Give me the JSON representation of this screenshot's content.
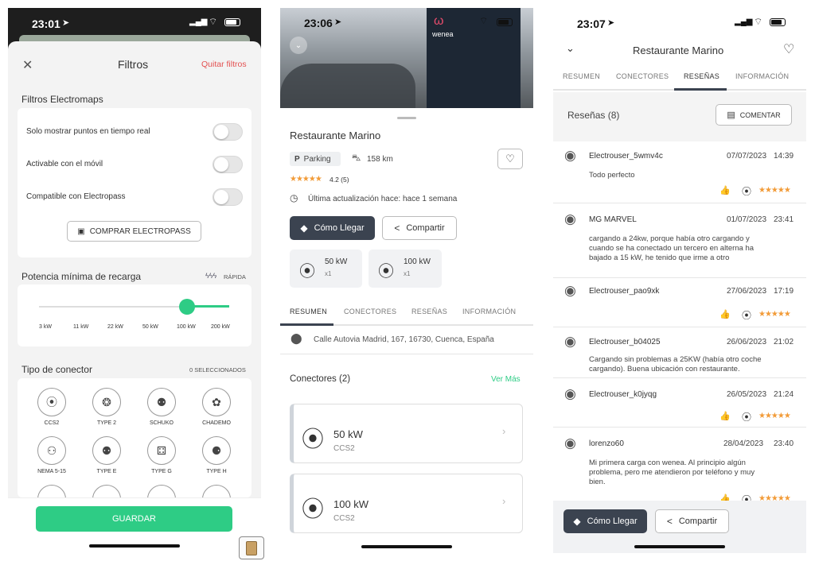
{
  "left": {
    "time": "23:01",
    "header": {
      "title": "Filtros",
      "clear": "Quitar filtros"
    },
    "electromaps": {
      "title": "Filtros Electromaps",
      "toggles": [
        "Solo mostrar puntos en tiempo real",
        "Activable con el móvil",
        "Compatible con Electropass"
      ],
      "buy_button": "COMPRAR ELECTROPASS"
    },
    "power": {
      "title": "Potencia mínima de recarga",
      "badge": "RÁPIDA",
      "ticks": [
        "3 kW",
        "11 kW",
        "22 kW",
        "50 kW",
        "100 kW",
        "200 kW"
      ],
      "selected_index": 4
    },
    "connectors": {
      "title": "Tipo de conector",
      "count": "0 SELECCIONADOS",
      "items": [
        "CCS2",
        "TYPE 2",
        "SCHUKO",
        "CHADEMO",
        "NEMA 5-15",
        "TYPE E",
        "TYPE G",
        "TYPE H"
      ]
    },
    "save": "GUARDAR"
  },
  "middle": {
    "time": "23:06",
    "brand": "wenea",
    "name": "Restaurante Marino",
    "parking": "Parking",
    "distance": "158 km",
    "rating": "4.2 (5)",
    "updated": "Última actualización hace: hace 1 semana",
    "directions": "Cómo Llegar",
    "share": "Compartir",
    "chips": [
      {
        "power": "50 kW",
        "count": "x1"
      },
      {
        "power": "100 kW",
        "count": "x1"
      }
    ],
    "tabs": [
      "RESUMEN",
      "CONECTORES",
      "RESEÑAS",
      "INFORMACIÓN"
    ],
    "address": "Calle Autovia Madrid, 167, 16730, Cuenca, España",
    "connectors_title": "Conectores (2)",
    "see_more": "Ver Más",
    "connectors": [
      {
        "power": "50 kW",
        "type": "CCS2"
      },
      {
        "power": "100 kW",
        "type": "CCS2"
      }
    ]
  },
  "right": {
    "time": "23:07",
    "title": "Restaurante Marino",
    "tabs": [
      "RESUMEN",
      "CONECTORES",
      "RESEÑAS",
      "INFORMACIÓN"
    ],
    "reviews_title": "Reseñas (8)",
    "comment": "COMENTAR",
    "reviews": [
      {
        "user": "Electrouser_5wmv4c",
        "date": "07/07/2023",
        "time": "14:39",
        "text1": "Todo perfecto",
        "text2": "",
        "text3": ""
      },
      {
        "user": "MG MARVEL",
        "date": "01/07/2023",
        "time": "23:41",
        "text1": "cargando a 24kw, porque había otro cargando y",
        "text2": "cuando se ha conectado un tercero en alterna ha",
        "text3": "bajado a 15 kW, he tenido que irme a otro"
      },
      {
        "user": "Electrouser_pao9xk",
        "date": "27/06/2023",
        "time": "17:19",
        "text1": "",
        "text2": "",
        "text3": ""
      },
      {
        "user": "Electrouser_b04025",
        "date": "26/06/2023",
        "time": "21:02",
        "text1": "Cargando sin problemas a 25KW (había otro coche",
        "text2": "cargando). Buena ubicación con restaurante.",
        "text3": ""
      },
      {
        "user": "Electrouser_k0jyqg",
        "date": "26/05/2023",
        "time": "21:24",
        "text1": "",
        "text2": "",
        "text3": ""
      },
      {
        "user": "lorenzo60",
        "date": "28/04/2023",
        "time": "23:40",
        "text1": "Mi primera carga con wenea. Al principio algún",
        "text2": "problema, pero me atendieron por teléfono y muy",
        "text3": "bien."
      }
    ],
    "directions": "Cómo Llegar",
    "share": "Compartir"
  }
}
